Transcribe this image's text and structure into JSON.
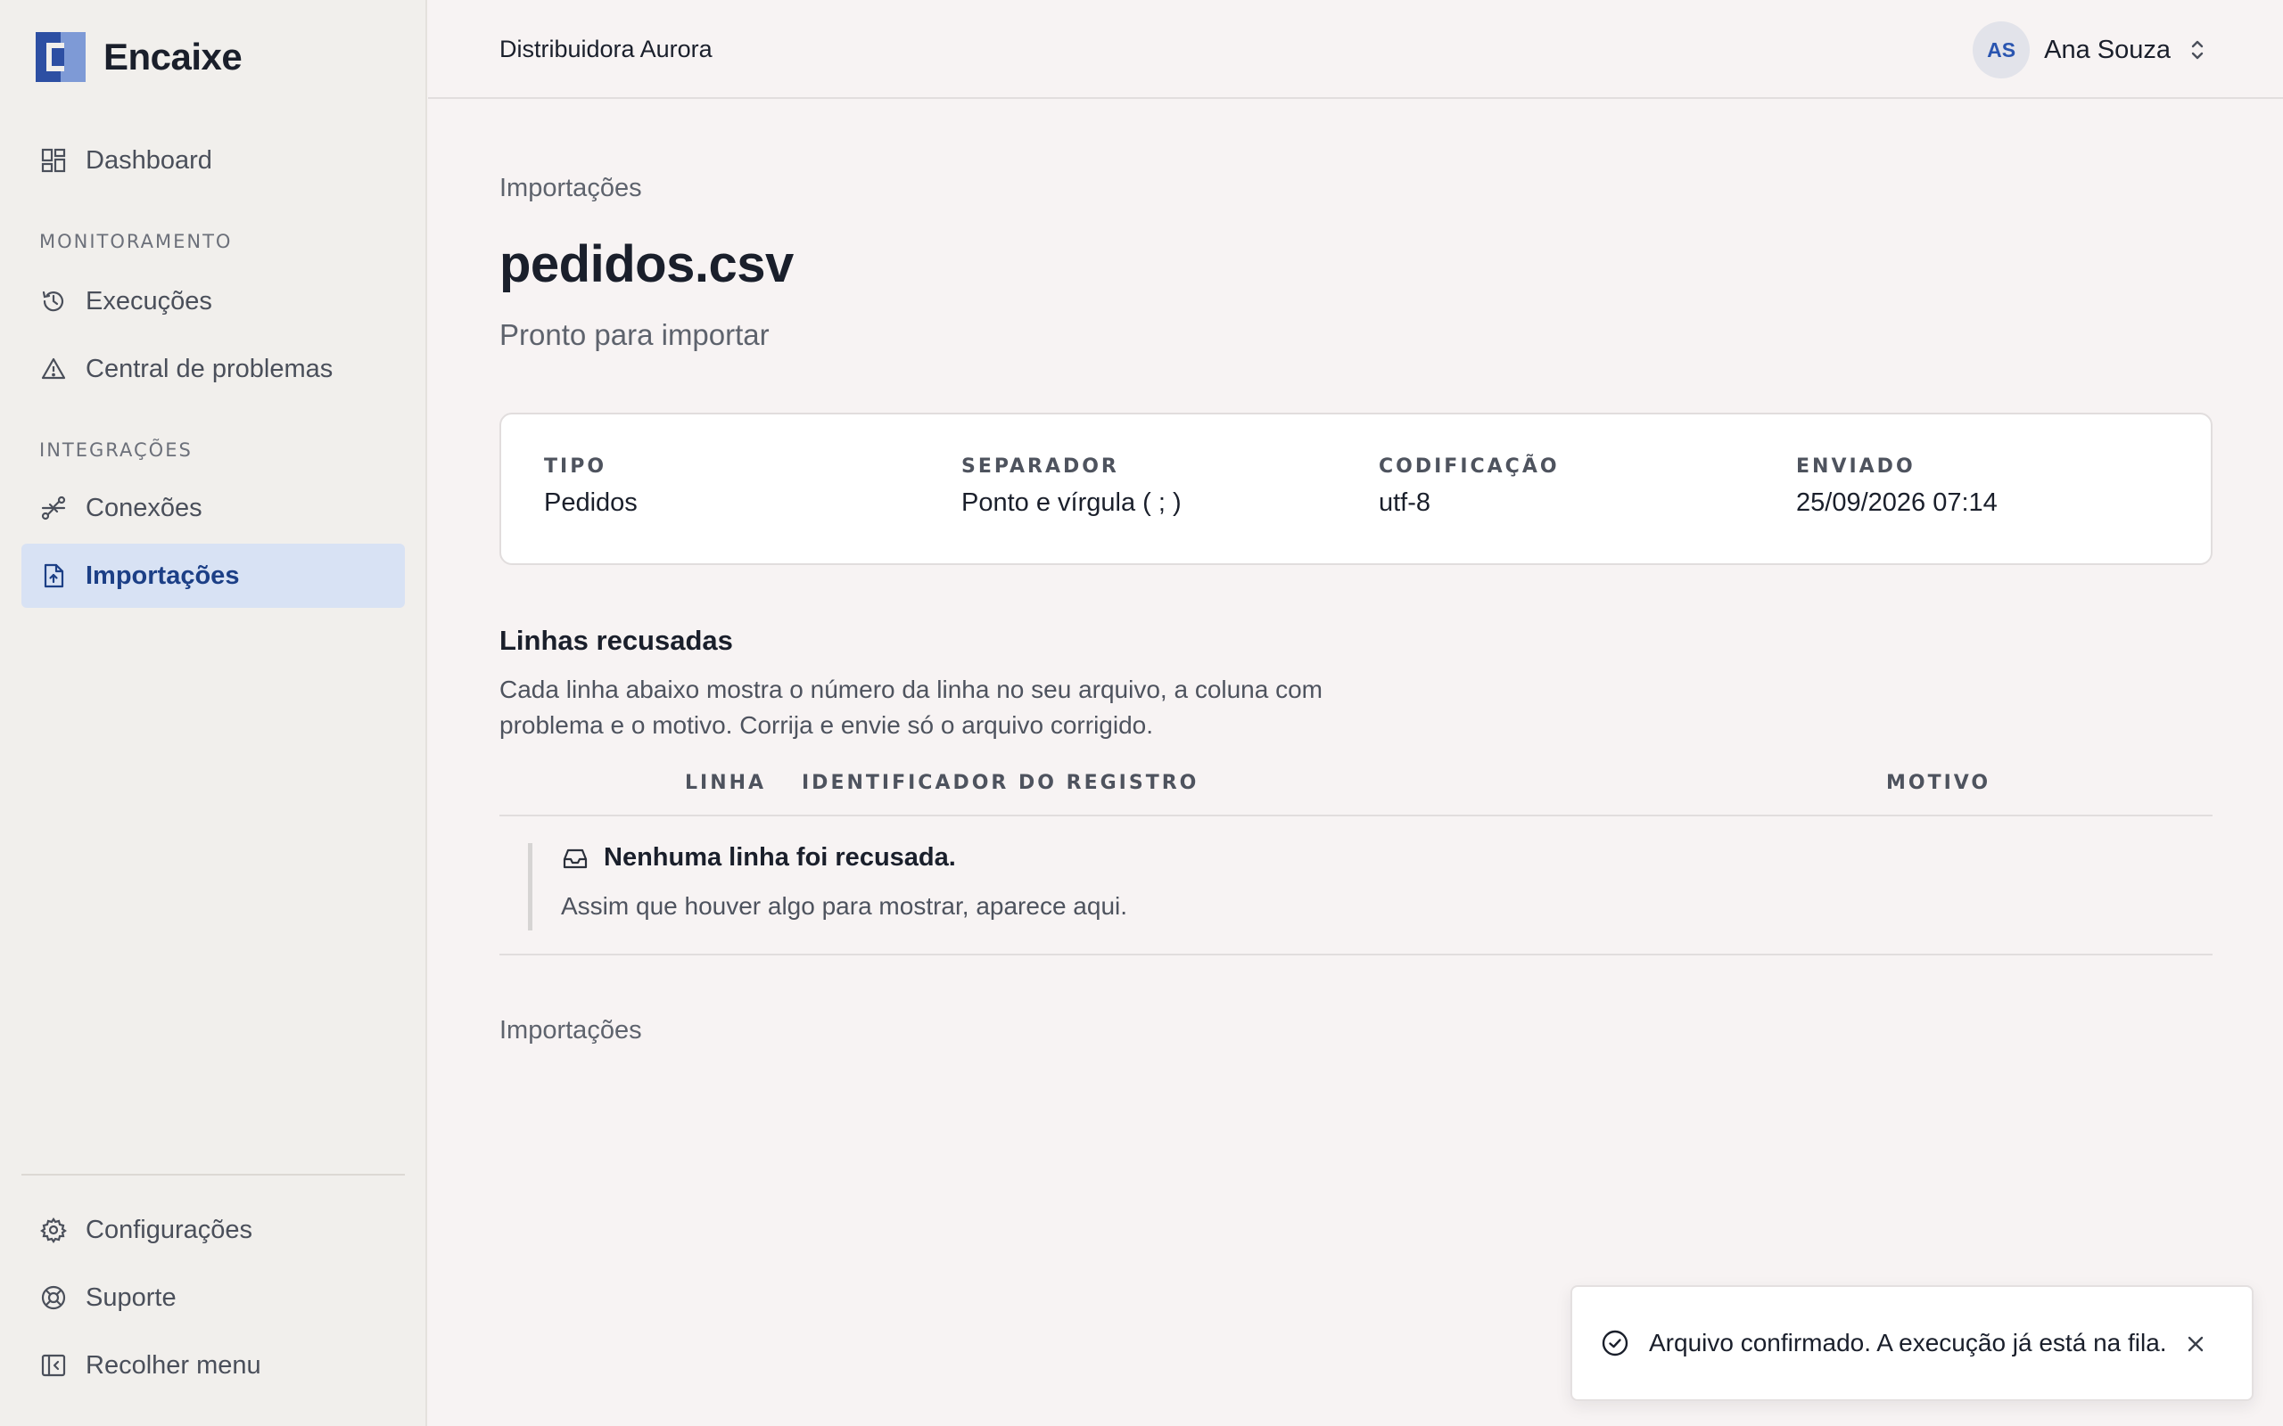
{
  "app": {
    "name": "Encaixe"
  },
  "colors": {
    "accent": "#1c3f86",
    "active_bg": "#d8e2f4",
    "avatar_text": "#2a55b0"
  },
  "sidebar": {
    "dashboard": {
      "label": "Dashboard",
      "icon": "dashboard-grid-icon"
    },
    "section_monitoring": "MONITORAMENTO",
    "executions": {
      "label": "Execuções",
      "icon": "history-icon"
    },
    "problems": {
      "label": "Central de problemas",
      "icon": "warning-triangle-icon"
    },
    "section_integrations": "INTEGRAÇÕES",
    "connections": {
      "label": "Conexões",
      "icon": "connections-icon"
    },
    "imports": {
      "label": "Importações",
      "icon": "file-upload-icon",
      "active": true
    },
    "settings": {
      "label": "Configurações",
      "icon": "gear-icon"
    },
    "support": {
      "label": "Suporte",
      "icon": "lifebuoy-icon"
    },
    "collapse": {
      "label": "Recolher menu",
      "icon": "collapse-sidebar-icon"
    }
  },
  "header": {
    "org": "Distribuidora Aurora",
    "user_initials": "AS",
    "user_name": "Ana Souza"
  },
  "page": {
    "breadcrumb": "Importações",
    "title": "pedidos.csv",
    "status": "Pronto para importar",
    "meta": [
      {
        "label": "TIPO",
        "value": "Pedidos"
      },
      {
        "label": "SEPARADOR",
        "value": "Ponto e vírgula ( ; )"
      },
      {
        "label": "CODIFICAÇÃO",
        "value": "utf-8"
      },
      {
        "label": "ENVIADO",
        "value": "25/09/2026 07:14"
      }
    ],
    "rejected": {
      "title": "Linhas recusadas",
      "description": "Cada linha abaixo mostra o número da linha no seu arquivo, a coluna com problema e o motivo. Corrija e envie só o arquivo corrigido.",
      "columns": [
        "LINHA",
        "IDENTIFICADOR DO REGISTRO",
        "MOTIVO"
      ],
      "empty_title": "Nenhuma linha foi recusada.",
      "empty_desc": "Assim que houver algo para mostrar, aparece aqui."
    },
    "footer_crumb": "Importações"
  },
  "toast": {
    "message": "Arquivo confirmado. A execução já está na fila.",
    "icon": "check-circle-icon"
  }
}
